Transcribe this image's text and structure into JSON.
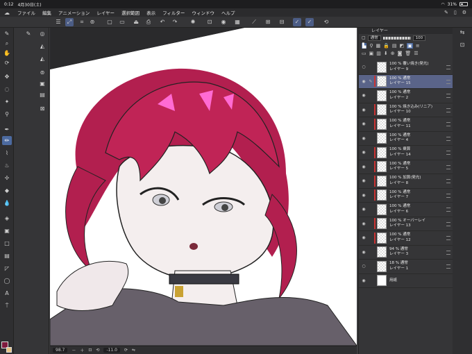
{
  "status": {
    "time": "0:12",
    "date": "4月30日(土)",
    "battery": "31%"
  },
  "menu": [
    "ファイル",
    "編集",
    "アニメーション",
    "レイヤー",
    "選択範囲",
    "表示",
    "フィルター",
    "ウィンドウ",
    "ヘルプ"
  ],
  "canvas_footer": {
    "zoom": "98.7",
    "angle": "-11.0"
  },
  "layer_panel": {
    "tab_label": "レイヤー",
    "blend_mode": "通常",
    "opacity": "100",
    "layers": [
      {
        "line1": "100 % 覆い焼き(発光)",
        "line2": "レイヤー 9",
        "selected": false,
        "clip": false,
        "eye": false
      },
      {
        "line1": "100 % 通常",
        "line2": "レイヤー 15",
        "selected": true,
        "clip": true,
        "eye": true
      },
      {
        "line1": "100 % 通常",
        "line2": "レイヤー 2",
        "selected": false,
        "clip": false,
        "eye": true
      },
      {
        "line1": "100 % 焼き込み(リニア)",
        "line2": "レイヤー 10",
        "selected": false,
        "clip": true,
        "eye": true
      },
      {
        "line1": "100 % 通常",
        "line2": "レイヤー 11",
        "selected": false,
        "clip": true,
        "eye": true
      },
      {
        "line1": "100 % 通常",
        "line2": "レイヤー 4",
        "selected": false,
        "clip": false,
        "eye": true
      },
      {
        "line1": "100 % 乗算",
        "line2": "レイヤー 14",
        "selected": false,
        "clip": true,
        "eye": true
      },
      {
        "line1": "100 % 通常",
        "line2": "レイヤー 5",
        "selected": false,
        "clip": true,
        "eye": true
      },
      {
        "line1": "100 % 加算(発光)",
        "line2": "レイヤー 8",
        "selected": false,
        "clip": true,
        "eye": true
      },
      {
        "line1": "100 % 通常",
        "line2": "レイヤー 7",
        "selected": false,
        "clip": true,
        "eye": true
      },
      {
        "line1": "100 % 通常",
        "line2": "レイヤー 6",
        "selected": false,
        "clip": false,
        "eye": true
      },
      {
        "line1": "100 % オーバーレイ",
        "line2": "レイヤー 13",
        "selected": false,
        "clip": true,
        "eye": true
      },
      {
        "line1": "100 % 通常",
        "line2": "レイヤー 12",
        "selected": false,
        "clip": true,
        "eye": true
      },
      {
        "line1": "94 % 通常",
        "line2": "レイヤー 3",
        "selected": false,
        "clip": false,
        "eye": true
      },
      {
        "line1": "18 % 通常",
        "line2": "レイヤー 1",
        "selected": false,
        "clip": false,
        "eye": false
      },
      {
        "line1": "",
        "line2": "用紙",
        "selected": false,
        "clip": false,
        "eye": true,
        "paper": true
      }
    ]
  },
  "colors": {
    "accent": "#4c6aa0",
    "main_color": "#7e1a3d",
    "sub_color": "#e6c383",
    "hair": "#b21f4f"
  }
}
